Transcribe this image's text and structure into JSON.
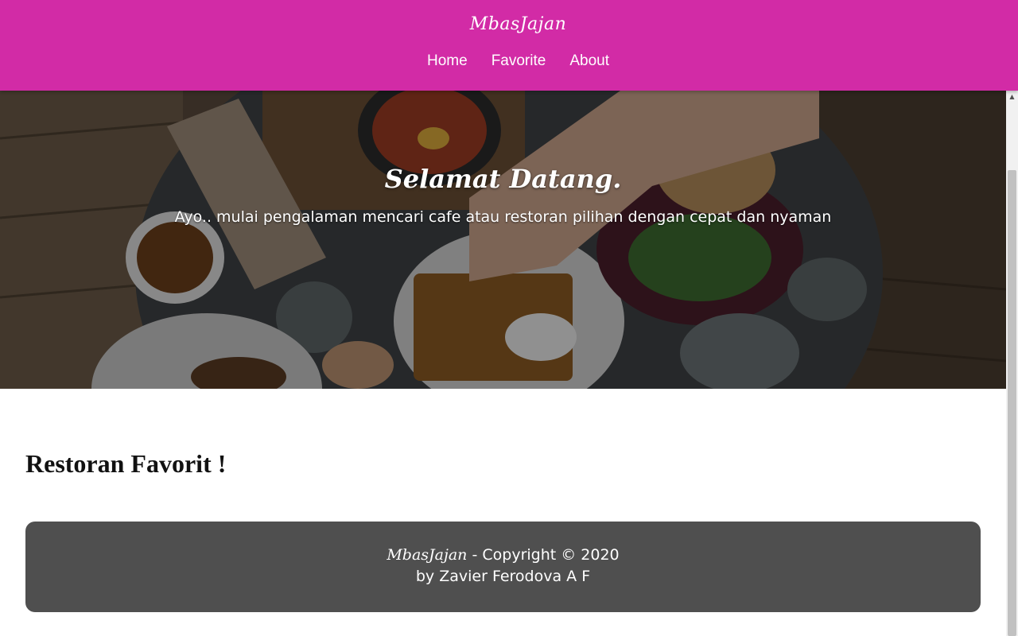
{
  "header": {
    "brand": "MbasJajan",
    "nav": [
      {
        "label": "Home"
      },
      {
        "label": "Favorite"
      },
      {
        "label": "About"
      }
    ]
  },
  "hero": {
    "title": "Selamat Datang.",
    "tagline": "Ayo.. mulai pengalaman mencari cafe atau restoran pilihan dengan cepat dan nyaman"
  },
  "main": {
    "section_title": "Restoran Favorit !"
  },
  "footer": {
    "brand": "MbasJajan",
    "copyright": " - Copyright © 2020",
    "author": "by Zavier Ferodova A F"
  },
  "colors": {
    "header_bg": "#d22ba6",
    "footer_bg": "#4f4f4f"
  },
  "icons": [
    "scroll-up-arrow-icon"
  ]
}
